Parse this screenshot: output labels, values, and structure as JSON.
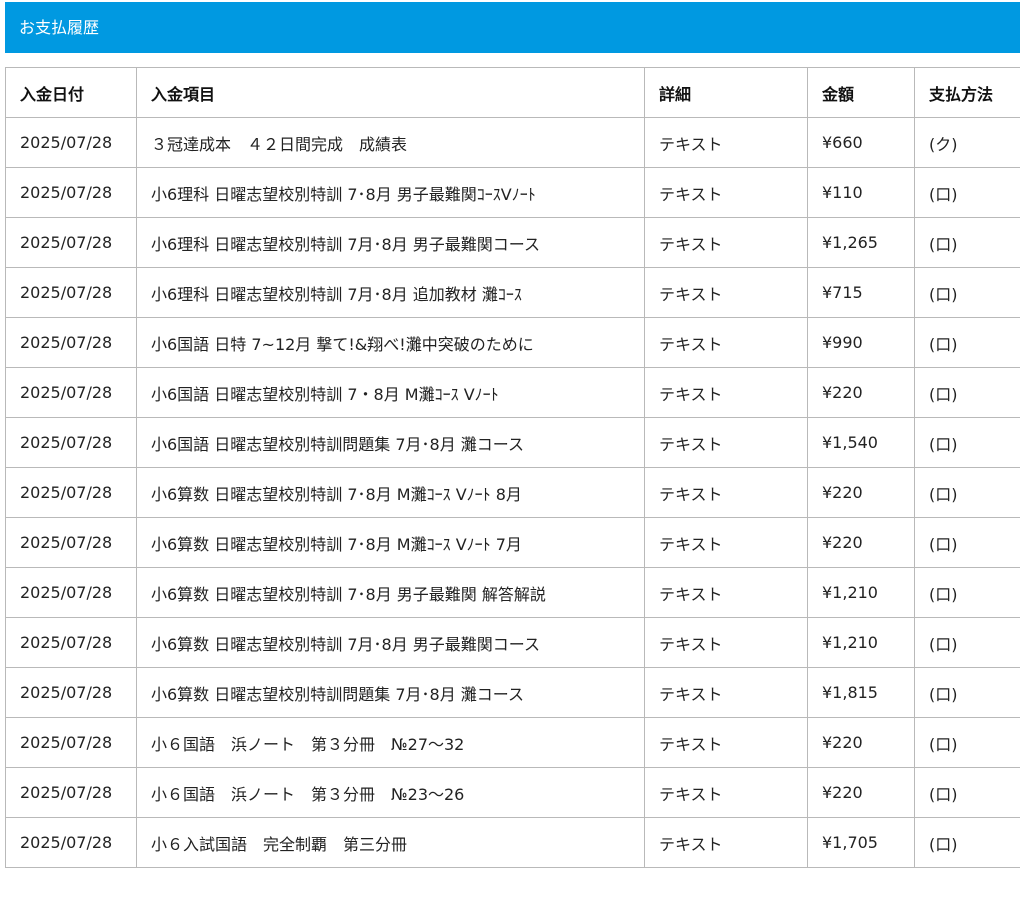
{
  "page": {
    "title": "お支払履歴"
  },
  "colors": {
    "header_bg": "#0099e1",
    "header_text": "#ffffff",
    "border": "#b9b9b9"
  },
  "table": {
    "columns": [
      "入金日付",
      "入金項目",
      "詳細",
      "金額",
      "支払方法"
    ],
    "rows": [
      {
        "date": "2025/07/28",
        "item": "３冠達成本　４２日間完成　成績表",
        "detail": "テキスト",
        "amount": "¥660",
        "method": "(ク)"
      },
      {
        "date": "2025/07/28",
        "item": "小6理科 日曜志望校別特訓 7･8月 男子最難関ｺｰｽVﾉｰﾄ",
        "detail": "テキスト",
        "amount": "¥110",
        "method": "(口)"
      },
      {
        "date": "2025/07/28",
        "item": "小6理科 日曜志望校別特訓 7月･8月 男子最難関コース",
        "detail": "テキスト",
        "amount": "¥1,265",
        "method": "(口)"
      },
      {
        "date": "2025/07/28",
        "item": "小6理科 日曜志望校別特訓 7月･8月 追加教材 灘ｺｰｽ",
        "detail": "テキスト",
        "amount": "¥715",
        "method": "(口)"
      },
      {
        "date": "2025/07/28",
        "item": "小6国語 日特 7~12月 撃て!&翔べ!灘中突破のために",
        "detail": "テキスト",
        "amount": "¥990",
        "method": "(口)"
      },
      {
        "date": "2025/07/28",
        "item": "小6国語 日曜志望校別特訓 7・8月 M灘ｺｰｽ Vﾉｰﾄ",
        "detail": "テキスト",
        "amount": "¥220",
        "method": "(口)"
      },
      {
        "date": "2025/07/28",
        "item": "小6国語 日曜志望校別特訓問題集 7月･8月 灘コース",
        "detail": "テキスト",
        "amount": "¥1,540",
        "method": "(口)"
      },
      {
        "date": "2025/07/28",
        "item": "小6算数 日曜志望校別特訓 7･8月 M灘ｺｰｽ Vﾉｰﾄ 8月",
        "detail": "テキスト",
        "amount": "¥220",
        "method": "(口)"
      },
      {
        "date": "2025/07/28",
        "item": "小6算数 日曜志望校別特訓 7･8月 M灘ｺｰｽ Vﾉｰﾄ 7月",
        "detail": "テキスト",
        "amount": "¥220",
        "method": "(口)"
      },
      {
        "date": "2025/07/28",
        "item": "小6算数 日曜志望校別特訓 7･8月 男子最難関 解答解説",
        "detail": "テキスト",
        "amount": "¥1,210",
        "method": "(口)"
      },
      {
        "date": "2025/07/28",
        "item": "小6算数 日曜志望校別特訓 7月･8月 男子最難関コース",
        "detail": "テキスト",
        "amount": "¥1,210",
        "method": "(口)"
      },
      {
        "date": "2025/07/28",
        "item": "小6算数 日曜志望校別特訓問題集 7月･8月 灘コース",
        "detail": "テキスト",
        "amount": "¥1,815",
        "method": "(口)"
      },
      {
        "date": "2025/07/28",
        "item": "小６国語　浜ノート　第３分冊　№27～32",
        "detail": "テキスト",
        "amount": "¥220",
        "method": "(口)"
      },
      {
        "date": "2025/07/28",
        "item": "小６国語　浜ノート　第３分冊　№23～26",
        "detail": "テキスト",
        "amount": "¥220",
        "method": "(口)"
      },
      {
        "date": "2025/07/28",
        "item": "小６入試国語　完全制覇　第三分冊",
        "detail": "テキスト",
        "amount": "¥1,705",
        "method": "(口)"
      }
    ]
  }
}
